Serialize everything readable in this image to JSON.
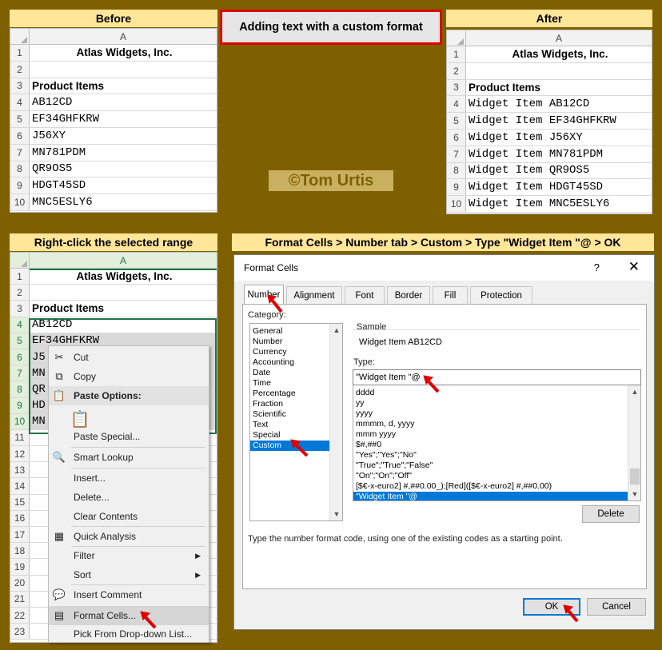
{
  "title": "Adding text with a custom format",
  "watermark": "©Tom Urtis",
  "before": {
    "header": "Before",
    "col": "A",
    "rows": [
      {
        "n": "1",
        "v": "Atlas Widgets, Inc."
      },
      {
        "n": "2",
        "v": ""
      },
      {
        "n": "3",
        "v": "Product Items"
      },
      {
        "n": "4",
        "v": "AB12CD"
      },
      {
        "n": "5",
        "v": "EF34GHFKRW"
      },
      {
        "n": "6",
        "v": "J56XY"
      },
      {
        "n": "7",
        "v": "MN781PDM"
      },
      {
        "n": "8",
        "v": "QR9OS5"
      },
      {
        "n": "9",
        "v": "HDGT45SD"
      },
      {
        "n": "10",
        "v": "MNC5ESLY6"
      }
    ]
  },
  "after": {
    "header": "After",
    "col": "A",
    "rows": [
      {
        "n": "1",
        "v": "Atlas Widgets, Inc."
      },
      {
        "n": "2",
        "v": ""
      },
      {
        "n": "3",
        "v": "Product Items"
      },
      {
        "n": "4",
        "v": "Widget Item AB12CD"
      },
      {
        "n": "5",
        "v": "Widget Item EF34GHFKRW"
      },
      {
        "n": "6",
        "v": "Widget Item J56XY"
      },
      {
        "n": "7",
        "v": "Widget Item MN781PDM"
      },
      {
        "n": "8",
        "v": "Widget Item QR9OS5"
      },
      {
        "n": "9",
        "v": "Widget Item HDGT45SD"
      },
      {
        "n": "10",
        "v": "Widget Item MNC5ESLY6"
      }
    ]
  },
  "rightclick": {
    "header": "Right-click the selected range",
    "col": "A",
    "rows": [
      {
        "n": "1",
        "v": "Atlas Widgets, Inc."
      },
      {
        "n": "2",
        "v": ""
      },
      {
        "n": "3",
        "v": "Product Items"
      },
      {
        "n": "4",
        "v": "AB12CD"
      },
      {
        "n": "5",
        "v": "EF34GHFKRW"
      },
      {
        "n": "6",
        "v": "J5"
      },
      {
        "n": "7",
        "v": "MN"
      },
      {
        "n": "8",
        "v": "QR"
      },
      {
        "n": "9",
        "v": "HD"
      },
      {
        "n": "10",
        "v": "MN"
      },
      {
        "n": "11",
        "v": ""
      },
      {
        "n": "12",
        "v": ""
      },
      {
        "n": "13",
        "v": ""
      },
      {
        "n": "14",
        "v": ""
      },
      {
        "n": "15",
        "v": ""
      },
      {
        "n": "16",
        "v": ""
      },
      {
        "n": "17",
        "v": ""
      },
      {
        "n": "18",
        "v": ""
      },
      {
        "n": "19",
        "v": ""
      },
      {
        "n": "20",
        "v": ""
      },
      {
        "n": "21",
        "v": ""
      },
      {
        "n": "22",
        "v": ""
      },
      {
        "n": "23",
        "v": ""
      }
    ],
    "menu": {
      "cut": "Cut",
      "copy": "Copy",
      "paste_options": "Paste Options:",
      "paste_special": "Paste Special...",
      "smart_lookup": "Smart Lookup",
      "insert": "Insert...",
      "delete": "Delete...",
      "clear_contents": "Clear Contents",
      "quick_analysis": "Quick Analysis",
      "filter": "Filter",
      "sort": "Sort",
      "insert_comment": "Insert Comment",
      "format_cells": "Format Cells...",
      "pick_list": "Pick From Drop-down List..."
    }
  },
  "dialog": {
    "header": "Format Cells > Number tab > Custom > Type \"Widget Item \"@ > OK",
    "title": "Format Cells",
    "help": "?",
    "close": "✕",
    "tabs": [
      "Number",
      "Alignment",
      "Font",
      "Border",
      "Fill",
      "Protection"
    ],
    "category_label": "Category:",
    "categories": [
      "General",
      "Number",
      "Currency",
      "Accounting",
      "Date",
      "Time",
      "Percentage",
      "Fraction",
      "Scientific",
      "Text",
      "Special",
      "Custom"
    ],
    "sample_label": "Sample",
    "sample_value": "Widget Item AB12CD",
    "type_label": "Type:",
    "type_value": "\"Widget Item \"@",
    "formats": [
      "dddd",
      "yy",
      "yyyy",
      "mmmm, d, yyyy",
      "mmm yyyy",
      "$#,##0",
      "\"Yes\";\"Yes\";\"No\"",
      "\"True\";\"True\";\"False\"",
      "\"On\";\"On\";\"Off\"",
      "[$€-x-euro2] #,##0.00_);[Red]([$€-x-euro2] #,##0.00)",
      "\"Widget Item \"@"
    ],
    "delete_btn": "Delete",
    "description": "Type the number format code, using one of the existing codes as a starting point.",
    "ok": "OK",
    "cancel": "Cancel"
  }
}
